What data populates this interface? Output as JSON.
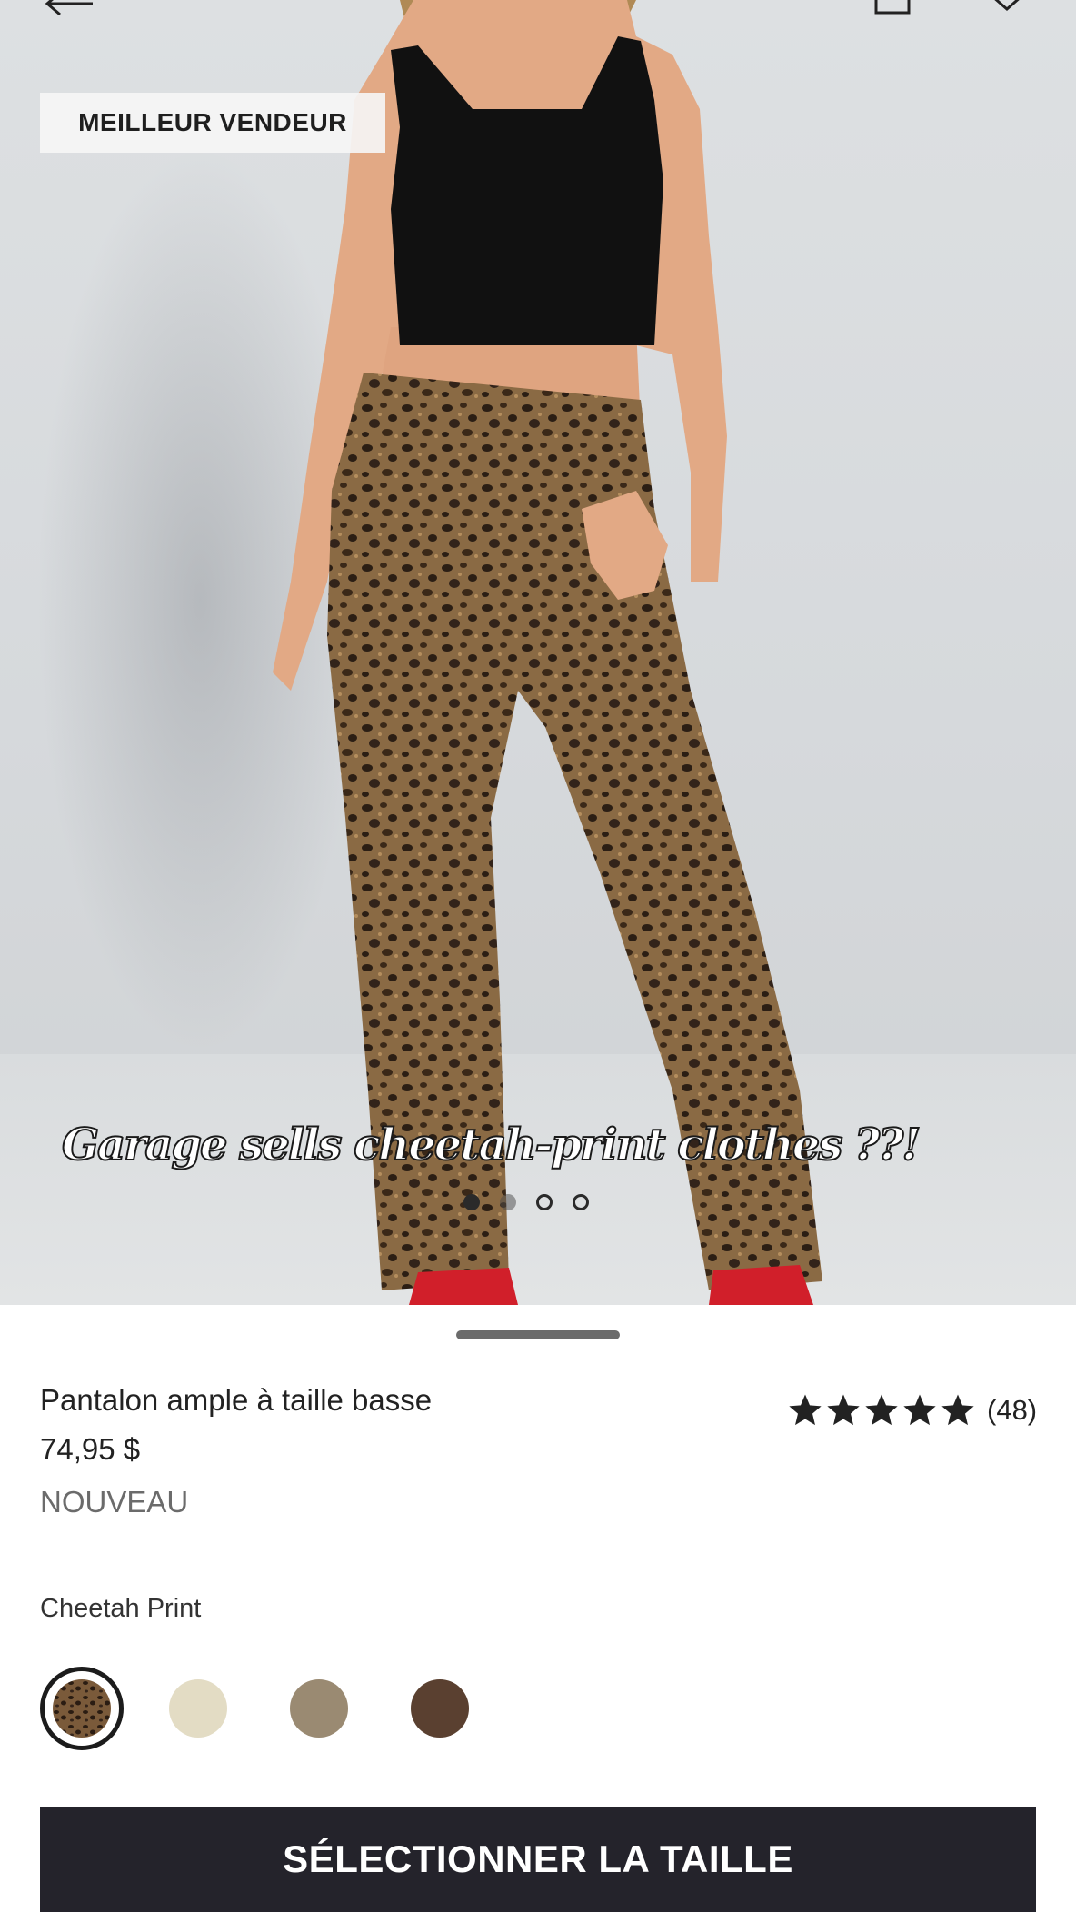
{
  "header": {
    "back_icon": "arrow-left-icon",
    "bag_icon": "shopping-bag-icon",
    "wishlist_icon": "heart-icon"
  },
  "gallery": {
    "badge": "MEILLEUR VENDEUR",
    "caption": "Garage sells cheetah-print  clothes ??!",
    "total_images": 4,
    "active_index": 0
  },
  "product": {
    "name": "Pantalon ample à taille basse",
    "price": "74,95 $",
    "tag": "NOUVEAU",
    "rating": 5,
    "review_count": "(48)",
    "selected_color": "Cheetah Print",
    "swatches": [
      {
        "color": "#4a3624",
        "pattern": "cheetah",
        "selected": true
      },
      {
        "color": "#e3dcc4",
        "selected": false
      },
      {
        "color": "#9a8a72",
        "selected": false
      },
      {
        "color": "#5a4030",
        "selected": false
      }
    ]
  },
  "actions": {
    "select_size": "SÉLECTIONNER LA TAILLE"
  },
  "colors": {
    "cta_background": "#24232b",
    "text_primary": "#222222",
    "text_muted": "#6b6b6b"
  }
}
